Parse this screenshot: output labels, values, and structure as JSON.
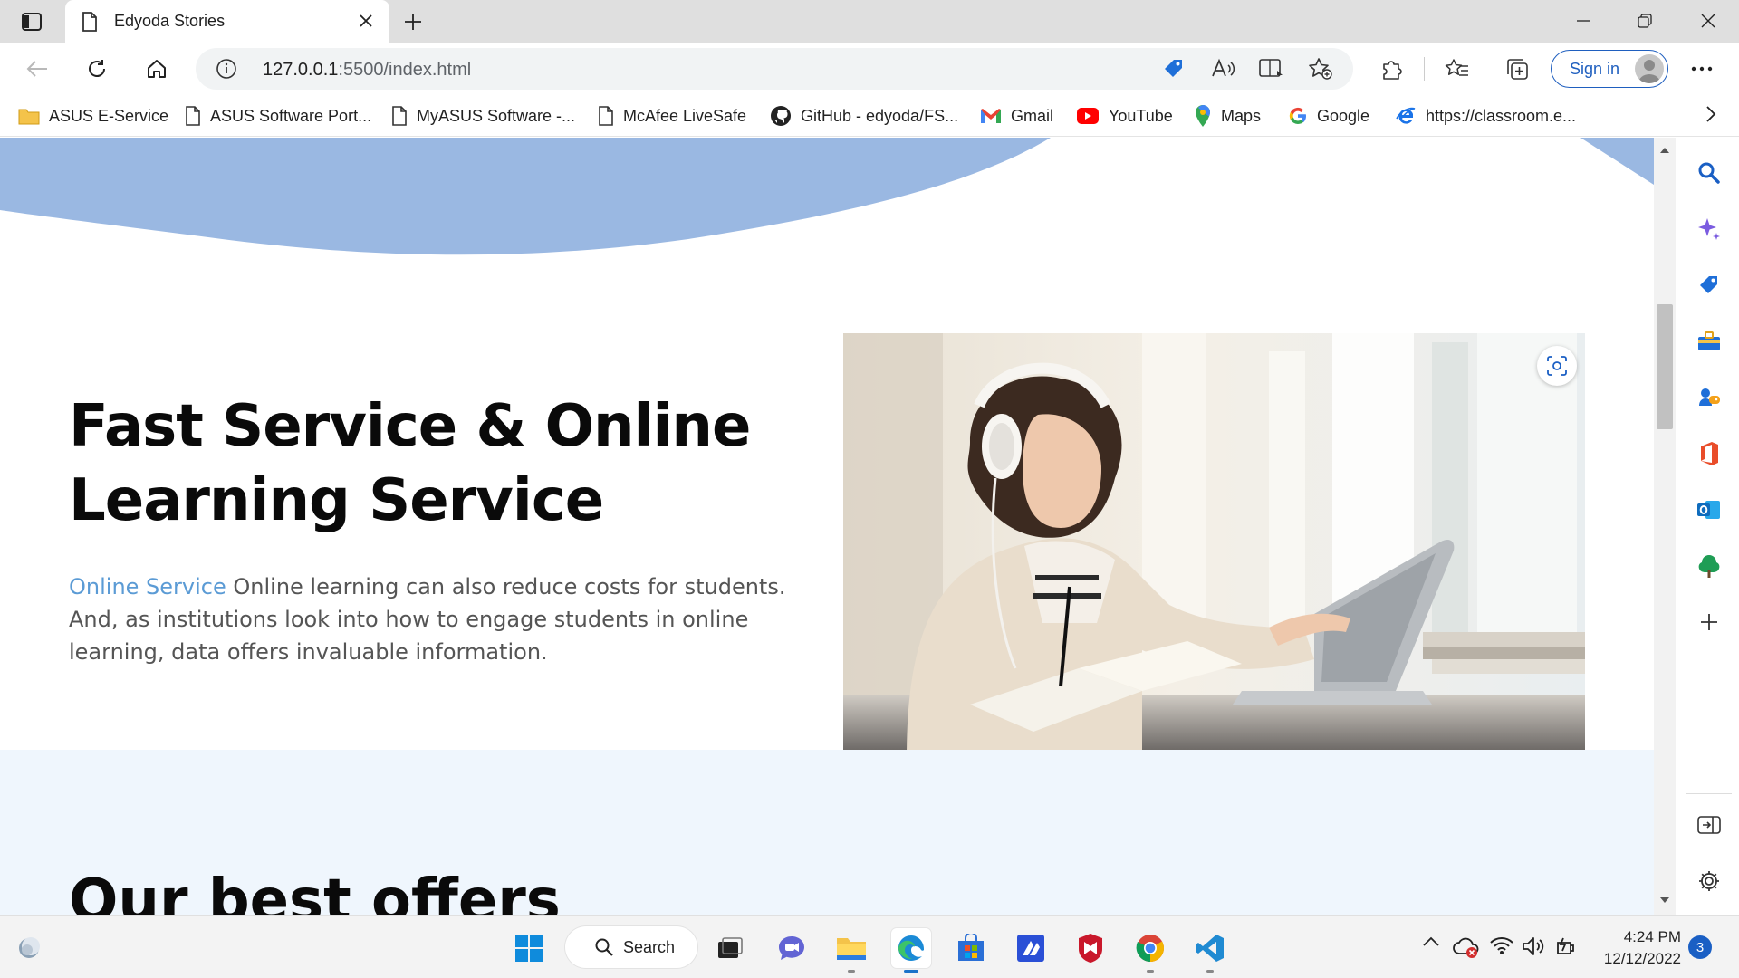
{
  "browser": {
    "tab": {
      "title": "Edyoda Stories"
    },
    "address": {
      "host": "127.0.0.1",
      "rest": ":5500/index.html"
    },
    "sign_in": "Sign in",
    "favorites": [
      {
        "label": "ASUS E-Service",
        "icon": "folder-icon"
      },
      {
        "label": "ASUS Software Port...",
        "icon": "page-icon"
      },
      {
        "label": "MyASUS Software -...",
        "icon": "page-icon"
      },
      {
        "label": "McAfee LiveSafe",
        "icon": "page-icon"
      },
      {
        "label": "GitHub - edyoda/FS...",
        "icon": "github-icon"
      },
      {
        "label": "Gmail",
        "icon": "gmail-icon"
      },
      {
        "label": "YouTube",
        "icon": "youtube-icon"
      },
      {
        "label": "Maps",
        "icon": "maps-icon"
      },
      {
        "label": "Google",
        "icon": "google-icon"
      },
      {
        "label": "https://classroom.e...",
        "icon": "ie-icon"
      }
    ]
  },
  "page": {
    "hero": {
      "title_line1": "Fast Service & Online",
      "title_line2": "Learning Service",
      "highlight": "Online Service",
      "body": " Online learning can also reduce costs for students. And, as institutions look into how to engage students in online learning, data offers invaluable information."
    },
    "offers_title": "Our best offers"
  },
  "taskbar": {
    "search": "Search",
    "time": "4:24 PM",
    "date": "12/12/2022",
    "notifications": "3"
  },
  "colors": {
    "wave": "#9ab8e2",
    "accent": "#5b9bd5",
    "offers_bg": "#eff6fd",
    "edge_blue": "#1f5fbf"
  }
}
